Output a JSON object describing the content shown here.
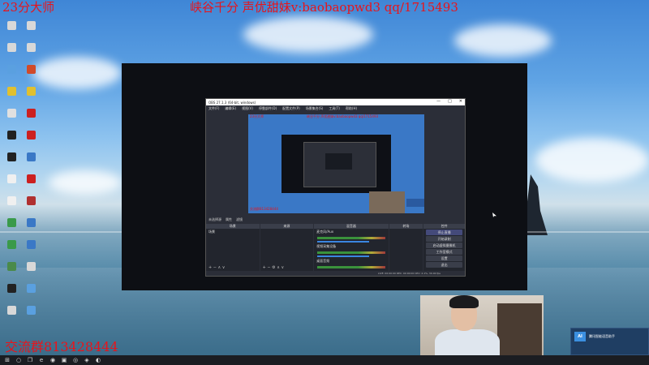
{
  "overlays": {
    "top_left": "23分大师",
    "top_right": "峡谷千分 声优甜妹v:baobaopwd3 qq/1715493",
    "bottom_left": "交流群813428444"
  },
  "desktop_icons": [
    {
      "label": "",
      "color": "#d8d8d8"
    },
    {
      "label": "",
      "color": "#d8d8d8"
    },
    {
      "label": "",
      "color": "#d8d8d8"
    },
    {
      "label": "",
      "color": "#d8d8d8"
    },
    {
      "label": "",
      "color": "#5aa0e0"
    },
    {
      "label": "",
      "color": "#d04a2a"
    },
    {
      "label": "",
      "color": "#e0c030"
    },
    {
      "label": "",
      "color": "#e0c030"
    },
    {
      "label": "",
      "color": "#e0e0e0"
    },
    {
      "label": "",
      "color": "#cc2020"
    },
    {
      "label": "",
      "color": "#222222"
    },
    {
      "label": "",
      "color": "#cc2020"
    },
    {
      "label": "",
      "color": "#222222"
    },
    {
      "label": "",
      "color": "#3a78c6"
    },
    {
      "label": "",
      "color": "#f0f0f0"
    },
    {
      "label": "",
      "color": "#cc2020"
    },
    {
      "label": "",
      "color": "#f0f0f0"
    },
    {
      "label": "",
      "color": "#b03030"
    },
    {
      "label": "",
      "color": "#3a9a4a"
    },
    {
      "label": "",
      "color": "#3a78c6"
    },
    {
      "label": "",
      "color": "#3a9a4a"
    },
    {
      "label": "",
      "color": "#3a78c6"
    },
    {
      "label": "",
      "color": "#4a8a4a"
    },
    {
      "label": "",
      "color": "#d8d8d8"
    },
    {
      "label": "",
      "color": "#222222"
    },
    {
      "label": "",
      "color": "#5aa0e0"
    },
    {
      "label": "",
      "color": "#d8d8d8"
    },
    {
      "label": "",
      "color": "#5aa0e0"
    }
  ],
  "obs": {
    "title": "OBS 27.1.3 (64-bit, windows)",
    "window_buttons": [
      "—",
      "□",
      "✕"
    ],
    "menu": [
      "文件(F)",
      "编辑(E)",
      "视图(V)",
      "停靠部件(D)",
      "配置文件(P)",
      "场景集合(S)",
      "工具(T)",
      "帮助(H)"
    ],
    "midbar": [
      "未选择源",
      "属性",
      "滤镜"
    ],
    "panels": {
      "scenes": {
        "title": "场景",
        "items": [
          "场景"
        ]
      },
      "sources": {
        "title": "来源",
        "items": []
      },
      "mixer": {
        "title": "混音器",
        "tracks": [
          "麦克风/Aux",
          "视频采集设备",
          "桌面音频"
        ]
      },
      "transitions": {
        "title": "转场",
        "items": []
      },
      "controls": {
        "title": "控件",
        "buttons": [
          "停止直播",
          "开始录制",
          "启动虚拟摄像机",
          "工作室模式",
          "设置",
          "退出"
        ]
      }
    },
    "status": "LIVE: 00:00:00  REC: 00:00:00  CPU: 2.1%, 30.00 fps"
  },
  "notification": {
    "logo": "AI",
    "title": "腾讯智能语音助手",
    "body": ""
  },
  "taskbar": {
    "icons": [
      "⊞",
      "○",
      "❐",
      "e",
      "◉",
      "▣",
      "◎",
      "◈",
      "◐"
    ],
    "clock_time": "",
    "clock_date": ""
  },
  "colors": {
    "overlay_red": "#e8141b",
    "obs_bg": "#2b2e38",
    "accent_blue": "#3a86e0"
  }
}
